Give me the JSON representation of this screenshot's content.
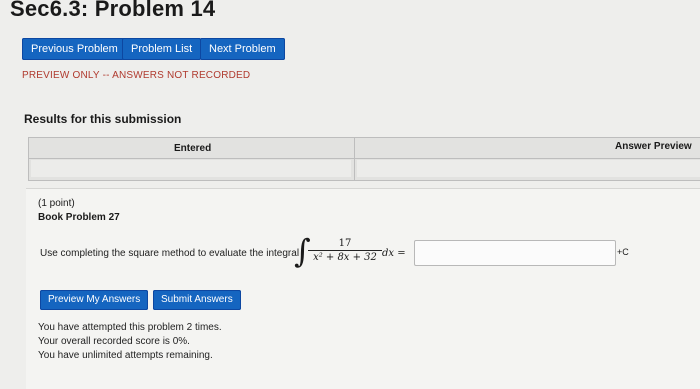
{
  "page": {
    "title": "Sec6.3: Problem 14"
  },
  "nav": {
    "previous": "Previous Problem",
    "list": "Problem List",
    "next": "Next Problem"
  },
  "preview_note": "PREVIEW ONLY -- ANSWERS NOT RECORDED",
  "results": {
    "title": "Results for this submission",
    "columns": [
      "Entered",
      "Answer Preview"
    ]
  },
  "problem": {
    "points": "(1 point)",
    "book": "Book Problem 27",
    "question": "Use completing the square method to evaluate the integral",
    "numerator": "17",
    "denominator": "x² + 8x + 32",
    "dx": "dx =",
    "answer_value": "",
    "plus_c": "+C"
  },
  "actions": {
    "preview": "Preview My Answers",
    "submit": "Submit Answers"
  },
  "status": {
    "attempts": "You have attempted this problem 2 times.",
    "score": "Your overall recorded score is 0%.",
    "remaining": "You have unlimited attempts remaining."
  },
  "colors": {
    "button": "#1565c0",
    "preview_note": "#b03a2e"
  }
}
